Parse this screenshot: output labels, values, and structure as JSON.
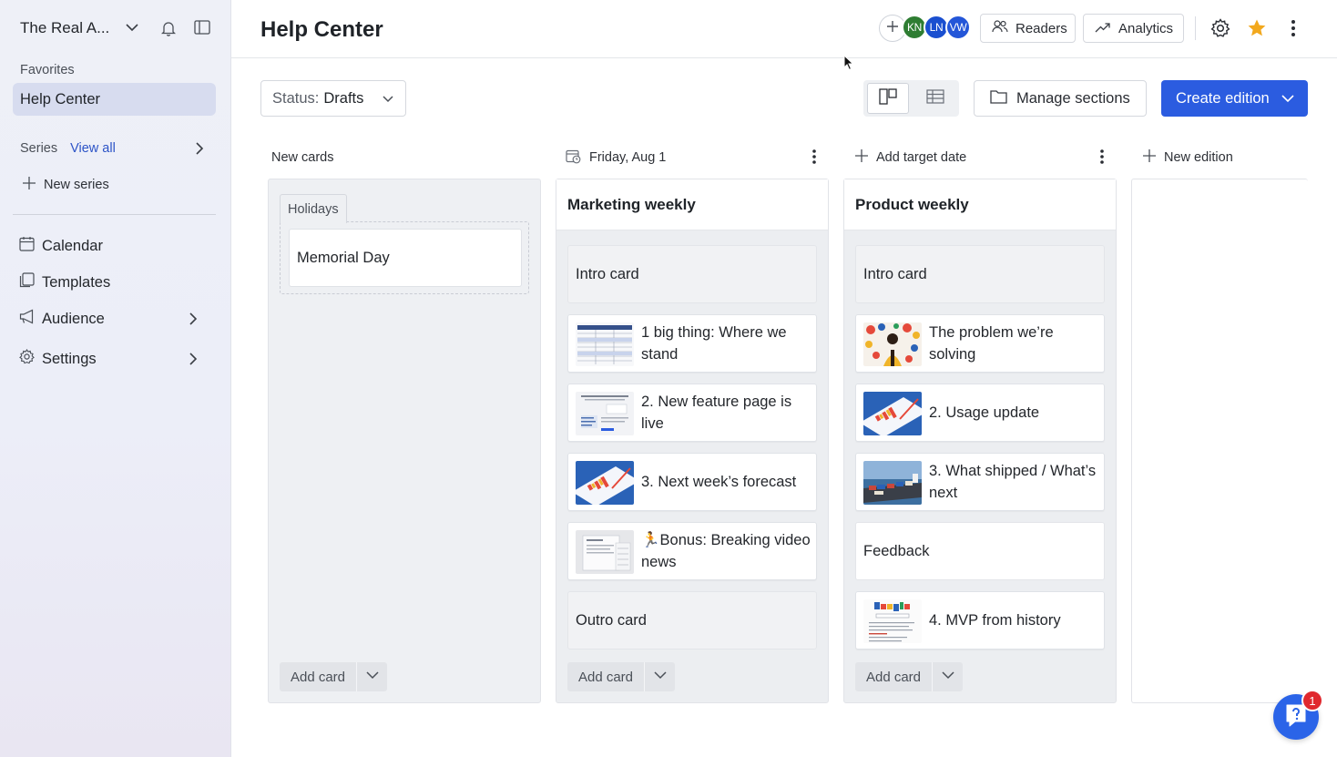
{
  "sidebar": {
    "workspace_name": "The Real A...",
    "favorites_label": "Favorites",
    "favorite_item": "Help Center",
    "series_label": "Series",
    "view_all": "View all",
    "new_series": "New series",
    "nav": [
      {
        "label": "Calendar",
        "icon": "calendar-icon"
      },
      {
        "label": "Templates",
        "icon": "templates-icon"
      },
      {
        "label": "Audience",
        "icon": "megaphone-icon"
      },
      {
        "label": "Settings",
        "icon": "gear-icon"
      }
    ]
  },
  "header": {
    "title": "Help Center",
    "avatars": [
      {
        "initials": "KN",
        "color": "#2e7d32"
      },
      {
        "initials": "LN",
        "color": "#1a4fd0"
      },
      {
        "initials": "VW",
        "color": "#2456d8"
      }
    ],
    "readers_label": "Readers",
    "analytics_label": "Analytics",
    "star_color": "#f2a81d"
  },
  "toolbar": {
    "status_key": "Status:",
    "status_value": "Drafts",
    "manage_sections": "Manage sections",
    "create_edition": "Create edition",
    "accent": "#2b5ce0"
  },
  "columns": {
    "new_cards": {
      "header": "New cards",
      "group_label": "Holidays",
      "card": "Memorial Day",
      "add_card": "Add card"
    },
    "marketing": {
      "date": "Friday, Aug 1",
      "title": "Marketing weekly",
      "cards": [
        {
          "text": "Intro card",
          "thumb": null
        },
        {
          "text": "1 big thing: Where we stand",
          "thumb": "spreadsheet-thumbnail"
        },
        {
          "text": "2. New feature page is live",
          "thumb": "document-thumbnail"
        },
        {
          "text": "3. Next week’s forecast",
          "thumb": "chart-thumbnail"
        },
        {
          "text": "🏃Bonus: Breaking video news",
          "thumb": "form-thumbnail"
        },
        {
          "text": "Outro card",
          "thumb": null
        }
      ],
      "add_card": "Add card"
    },
    "product": {
      "date": "Add target date",
      "title": "Product weekly",
      "cards": [
        {
          "text": "Intro card",
          "thumb": null
        },
        {
          "text": "The problem we’re solving",
          "thumb": "person-icons-thumbnail"
        },
        {
          "text": "2. Usage update",
          "thumb": "chart-thumbnail"
        },
        {
          "text": "3. What shipped / What’s next",
          "thumb": "ship-thumbnail"
        },
        {
          "text": "Feedback",
          "thumb": null
        },
        {
          "text": "4. MVP from history",
          "thumb": "google-thumbnail"
        }
      ],
      "add_card": "Add card"
    },
    "new_edition": "New edition"
  },
  "help": {
    "badge": "1"
  }
}
